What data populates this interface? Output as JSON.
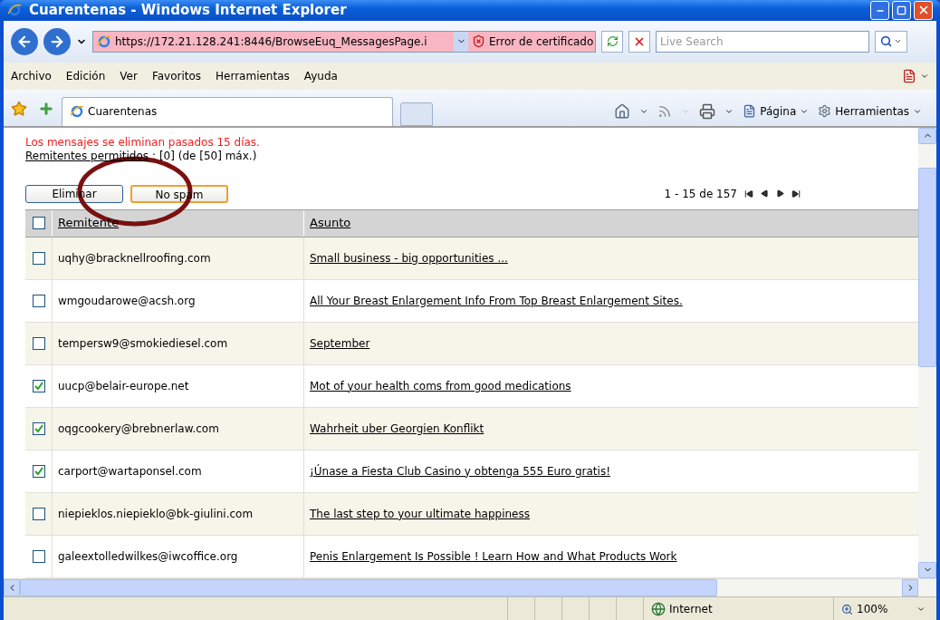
{
  "window": {
    "title": "Cuarentenas - Windows Internet Explorer"
  },
  "address_bar": {
    "url": "https://172.21.128.241:8446/BrowseEuq_MessagesPage.i",
    "certificate_error": "Error de certificado"
  },
  "search": {
    "placeholder": "Live Search"
  },
  "menu": [
    "Archivo",
    "Edición",
    "Ver",
    "Favoritos",
    "Herramientas",
    "Ayuda"
  ],
  "tabs": [
    {
      "label": "Cuarentenas",
      "selected": true
    }
  ],
  "command_bar": [
    "Página",
    "Herramientas"
  ],
  "page": {
    "notice": "Los mensajes se eliminan pasados 15 días.",
    "allowed_link": "Remitentes permitidos",
    "allowed_text": ": [0] (de [50] máx.)",
    "buttons": [
      {
        "label": "Eliminar",
        "focused": false
      },
      {
        "label": "No spam",
        "focused": true
      }
    ],
    "pagination": "1 - 15 de 157"
  },
  "table": {
    "select_all": {
      "checked": false
    },
    "columns": [
      "Remitente",
      "Asunto"
    ],
    "rows": [
      {
        "sender": "uqhy@bracknellroofing.com",
        "subject": "Small business - big opportunities ...",
        "checked": false
      },
      {
        "sender": "wmgoudarowe@acsh.org",
        "subject": "All Your Breast Enlargement Info From Top Breast Enlargement Sites.",
        "checked": false
      },
      {
        "sender": "tempersw9@smokiediesel.com",
        "subject": "September",
        "checked": false
      },
      {
        "sender": "uucp@belair-europe.net",
        "subject": "Mot of your health coms from good medications",
        "checked": true
      },
      {
        "sender": "oqgcookery@brebnerlaw.com",
        "subject": "Wahrheit uber Georgien Konflikt",
        "checked": true
      },
      {
        "sender": "carport@wartaponsel.com",
        "subject": "¡Únase a Fiesta Club Casino y obtenga 555 Euro gratis!",
        "checked": true
      },
      {
        "sender": "niepieklos.niepieklo@bk-giulini.com",
        "subject": "The last step to your ultimate happiness",
        "checked": false
      },
      {
        "sender": "galeextolledwilkes@iwcoffice.org",
        "subject": "Penis Enlargement Is Possible ! Learn How and What Products Work",
        "checked": false
      }
    ]
  },
  "status_bar": {
    "zone": "Internet",
    "zoom": "100%"
  }
}
